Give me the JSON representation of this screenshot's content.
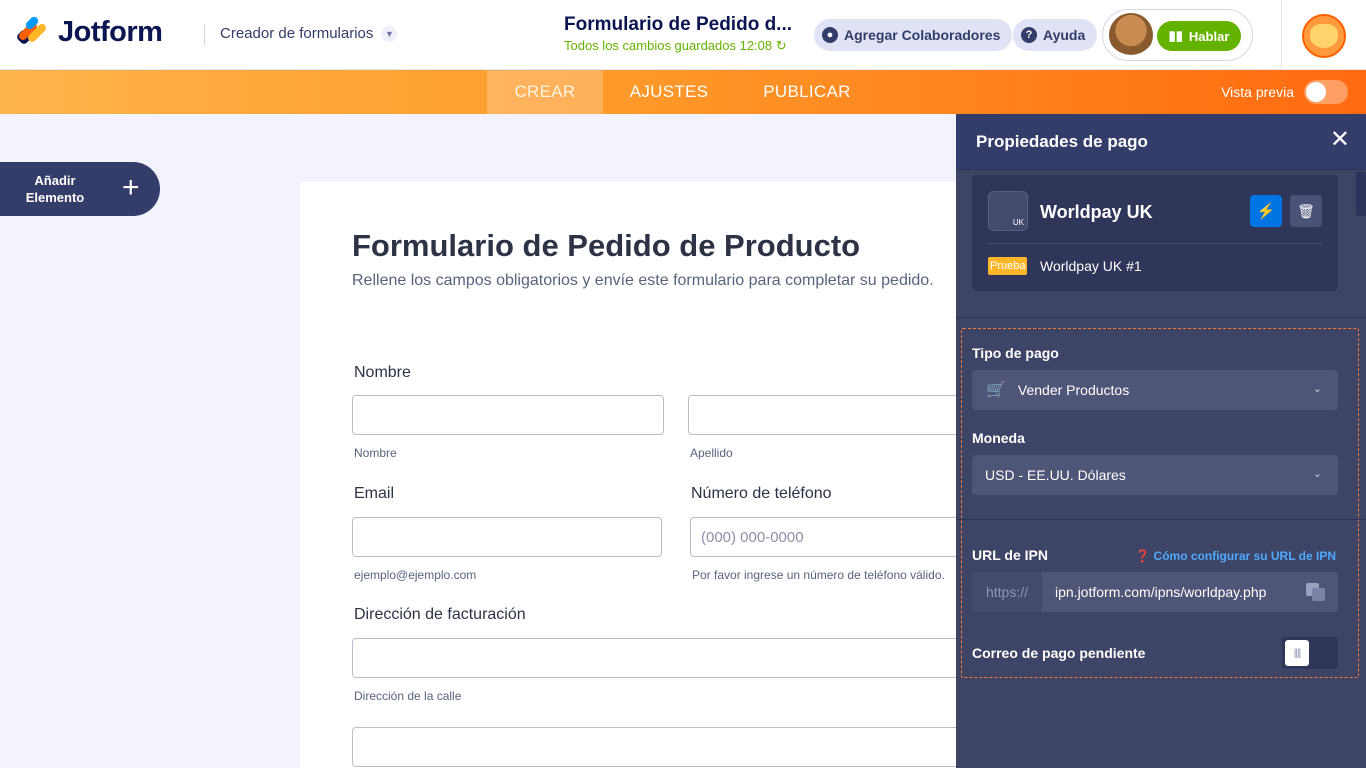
{
  "header": {
    "logo_text": "Jotform",
    "builder_label": "Creador de formularios",
    "form_title": "Formulario de Pedido d...",
    "saved_status": "Todos los cambios guardados 12:08",
    "collab_label": "Agregar Colaboradores",
    "help_label": "Ayuda",
    "talk_label": "Hablar"
  },
  "nav": {
    "tabs": [
      {
        "label": "CREAR",
        "active": true
      },
      {
        "label": "AJUSTES",
        "active": false
      },
      {
        "label": "PUBLICAR",
        "active": false
      }
    ],
    "preview_label": "Vista previa",
    "preview_on": false
  },
  "sidebar": {
    "add_element_line1": "Añadir",
    "add_element_line2": "Elemento"
  },
  "form": {
    "title": "Formulario de Pedido de Producto",
    "subtitle": "Rellene los campos obligatorios y envíe este formulario para completar su pedido.",
    "name_label": "Nombre",
    "first_sub": "Nombre",
    "last_sub": "Apellido",
    "email_label": "Email",
    "email_sub": "ejemplo@ejemplo.com",
    "phone_label": "Número de teléfono",
    "phone_placeholder": "(000) 000-0000",
    "phone_sub": "Por favor ingrese un número de teléfono válido.",
    "address_label": "Dirección de facturación",
    "street_sub": "Dirección de la calle"
  },
  "panel": {
    "title": "Propiedades de pago",
    "gateway_name": "Worldpay UK",
    "gateway_logo_text": "UK",
    "test_badge": "Prueba",
    "account_name": "Worldpay UK #1",
    "payment_type_label": "Tipo de pago",
    "payment_type_value": "Vender Productos",
    "currency_label": "Moneda",
    "currency_value": "USD - EE.UU. Dólares",
    "ipn_label": "URL de IPN",
    "ipn_help": "Cómo configurar su URL de IPN",
    "ipn_prefix": "https://",
    "ipn_value": "ipn.jotform.com/ipns/worldpay.php",
    "pending_email_label": "Correo de pago pendiente",
    "pending_email_on": false
  },
  "colors": {
    "accent_orange": "#ff6100",
    "panel_bg": "#3d4465",
    "talk_green": "#64b200",
    "connect_blue": "#0075e3"
  }
}
